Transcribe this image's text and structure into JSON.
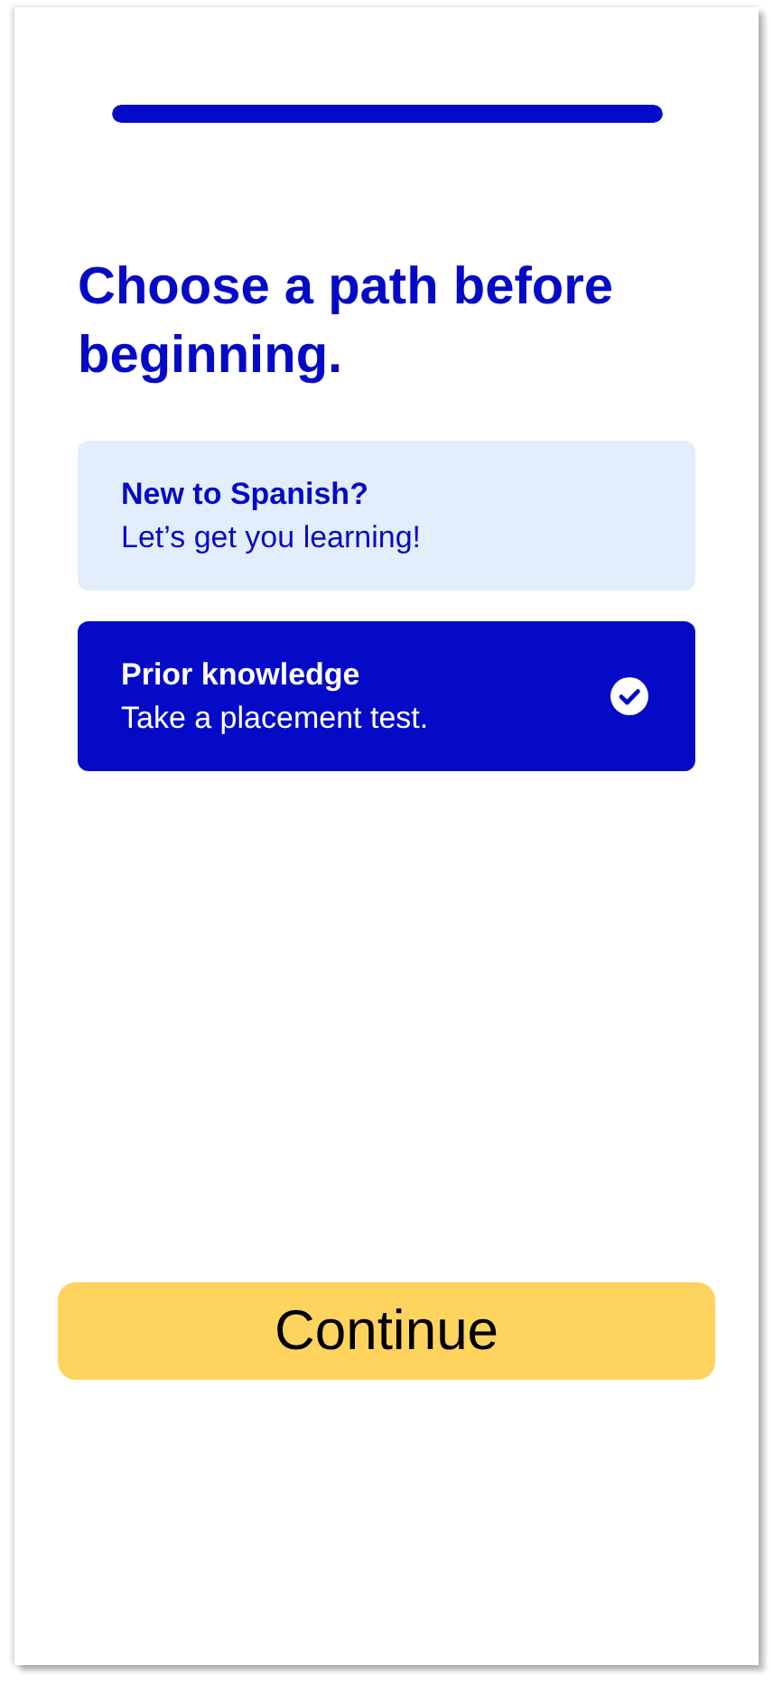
{
  "progress": {
    "level": 1
  },
  "heading": "Choose a path before beginning.",
  "options": [
    {
      "title": "New to Spanish?",
      "subtitle": "Let’s get you learning!",
      "selected": false
    },
    {
      "title": "Prior knowledge",
      "subtitle": "Take a placement test.",
      "selected": true
    }
  ],
  "continue_button": "Continue"
}
